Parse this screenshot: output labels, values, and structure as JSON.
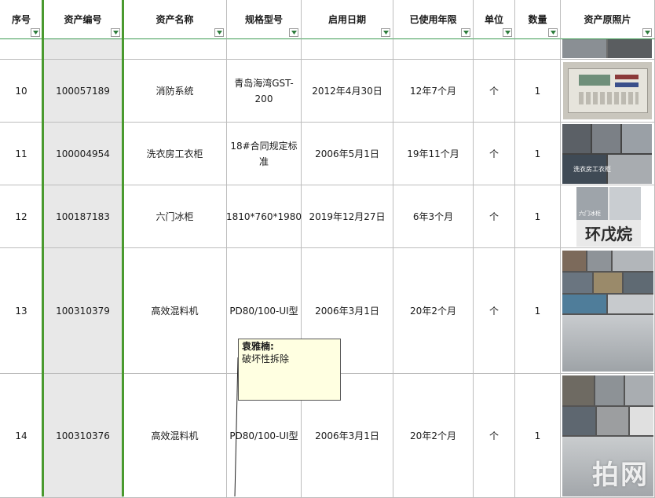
{
  "headers": {
    "seq": "序号",
    "asset_no": "资产编号",
    "asset_name": "资产名称",
    "spec": "规格型号",
    "start_date": "启用日期",
    "years_used": "已使用年限",
    "unit": "单位",
    "qty": "数量",
    "photo": "资产原照片"
  },
  "rows": [
    {
      "seq": "10",
      "asset_no": "100057189",
      "asset_name": "消防系统",
      "spec": "青岛海湾GST-200",
      "start_date": "2012年4月30日",
      "years_used": "12年7个月",
      "unit": "个",
      "qty": "1"
    },
    {
      "seq": "11",
      "asset_no": "100004954",
      "asset_name": "洗衣房工衣柜",
      "spec": "18#合同规定标准",
      "start_date": "2006年5月1日",
      "years_used": "19年11个月",
      "unit": "个",
      "qty": "1"
    },
    {
      "seq": "12",
      "asset_no": "100187183",
      "asset_name": "六门冰柜",
      "spec": "1810*760*1980",
      "start_date": "2019年12月27日",
      "years_used": "6年3个月",
      "unit": "个",
      "qty": "1"
    },
    {
      "seq": "13",
      "asset_no": "100310379",
      "asset_name": "高效混料机",
      "spec": "PD80/100-UI型",
      "start_date": "2006年3月1日",
      "years_used": "20年2个月",
      "unit": "个",
      "qty": "1"
    },
    {
      "seq": "14",
      "asset_no": "100310376",
      "asset_name": "高效混料机",
      "spec": "PD80/100-UI型",
      "start_date": "2006年3月1日",
      "years_used": "20年2个月",
      "unit": "个",
      "qty": "1"
    }
  ],
  "comment": {
    "author": "袁雅楠:",
    "text": "破坏性拆除"
  },
  "photo_captions": {
    "row11": "洗衣房工衣柜",
    "row12_banner": "环戊烷",
    "row12_small": "六门冰柜"
  },
  "watermark": "拍网",
  "icons": {
    "filter": "filter-dropdown-icon"
  }
}
